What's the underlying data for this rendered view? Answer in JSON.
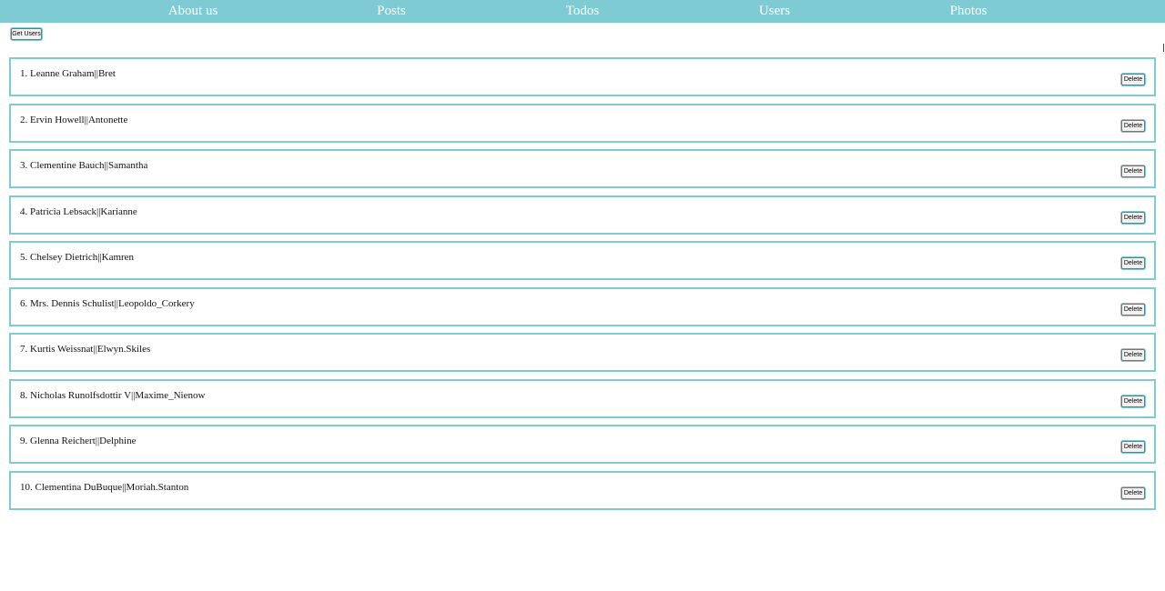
{
  "nav": {
    "items": [
      {
        "label": "About us"
      },
      {
        "label": "Posts"
      },
      {
        "label": "Todos"
      },
      {
        "label": "Users"
      },
      {
        "label": "Photos"
      }
    ]
  },
  "actions": {
    "get_users_label": "Get Users"
  },
  "users": [
    {
      "text": "1. Leanne Graham||Bret",
      "delete_label": "Delete"
    },
    {
      "text": "2. Ervin Howell||Antonette",
      "delete_label": "Delete"
    },
    {
      "text": "3. Clementine Bauch||Samantha",
      "delete_label": "Delete"
    },
    {
      "text": "4. Patricia Lebsack||Karianne",
      "delete_label": "Delete"
    },
    {
      "text": "5. Chelsey Dietrich||Kamren",
      "delete_label": "Delete"
    },
    {
      "text": "6. Mrs. Dennis Schulist||Leopoldo_Corkery",
      "delete_label": "Delete"
    },
    {
      "text": "7. Kurtis Weissnat||Elwyn.Skiles",
      "delete_label": "Delete"
    },
    {
      "text": "8. Nicholas Runolfsdottir V||Maxime_Nienow",
      "delete_label": "Delete"
    },
    {
      "text": "9. Glenna Reichert||Delphine",
      "delete_label": "Delete"
    },
    {
      "text": "10. Clementina DuBuque||Moriah.Stanton",
      "delete_label": "Delete"
    }
  ],
  "colors": {
    "accent": "#7ecbd3",
    "nav_text": "#ffffff"
  }
}
